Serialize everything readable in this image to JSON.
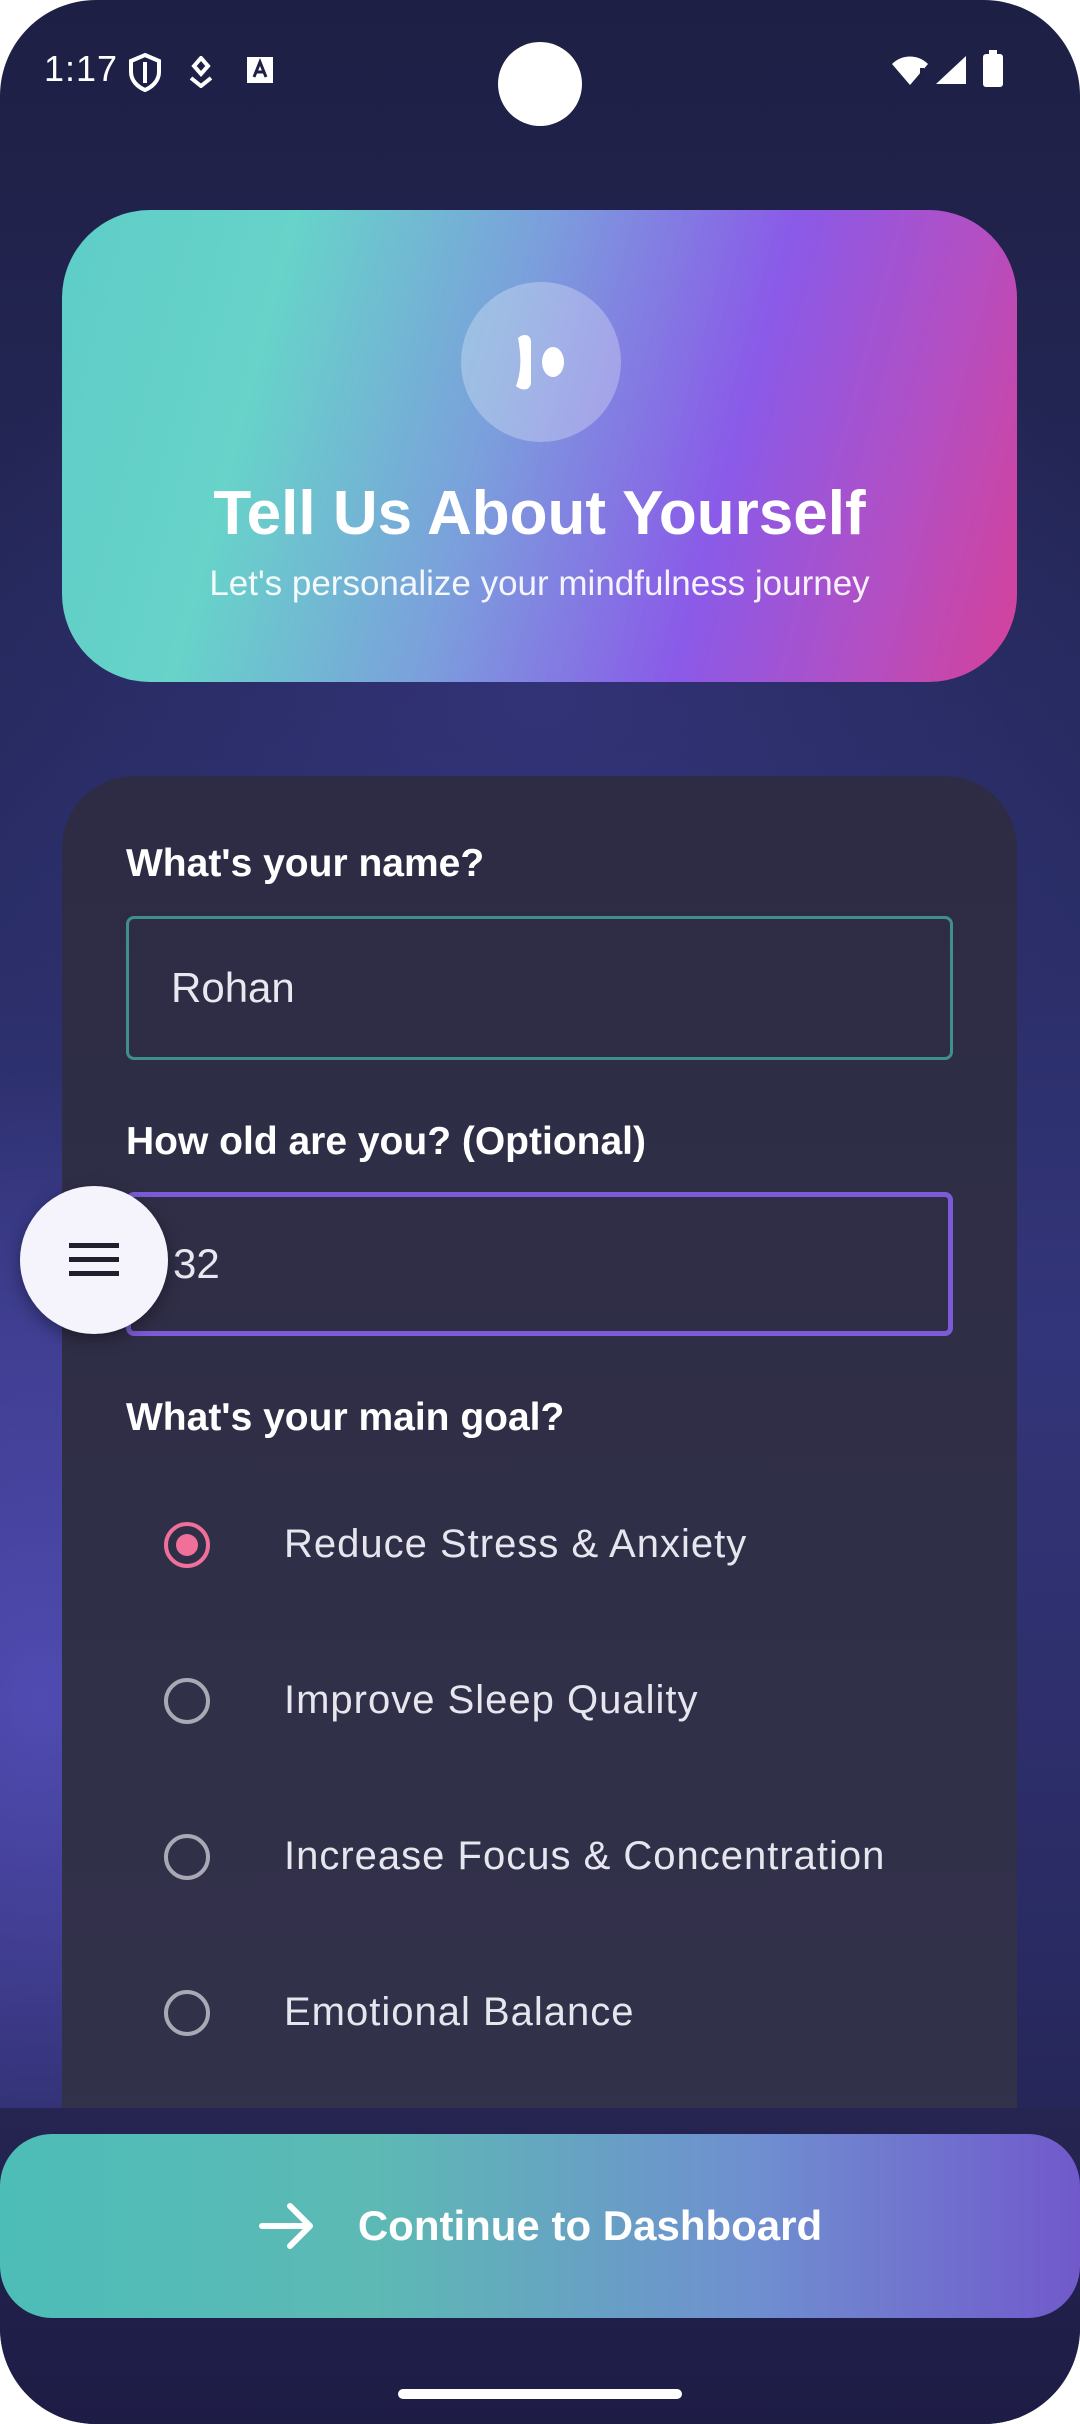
{
  "status_bar": {
    "time": "1:17",
    "icons": [
      "shield-icon",
      "notification-icon",
      "font-icon",
      "wifi-icon",
      "signal-icon",
      "battery-icon"
    ]
  },
  "header": {
    "logo_icon": "meditation-logo-icon",
    "title": "Tell Us About Yourself",
    "subtitle": "Let's personalize your mindfulness journey"
  },
  "form": {
    "name": {
      "label": "What's your name?",
      "value": "Rohan"
    },
    "age": {
      "label": "How old are you? (Optional)",
      "value": "32"
    },
    "goal": {
      "label": "What's your main goal?",
      "options": [
        {
          "label": "Reduce Stress & Anxiety",
          "selected": true
        },
        {
          "label": "Improve Sleep Quality",
          "selected": false
        },
        {
          "label": "Increase Focus & Concentration",
          "selected": false
        },
        {
          "label": "Emotional Balance",
          "selected": false
        }
      ]
    }
  },
  "fab": {
    "icon": "menu-icon"
  },
  "continue_button": {
    "icon": "arrow-right-icon",
    "label": "Continue to Dashboard"
  },
  "colors": {
    "accent_teal": "#5fcdc8",
    "accent_purple": "#8a5ae8",
    "accent_pink": "#f0709a",
    "background": "#262a5e"
  }
}
